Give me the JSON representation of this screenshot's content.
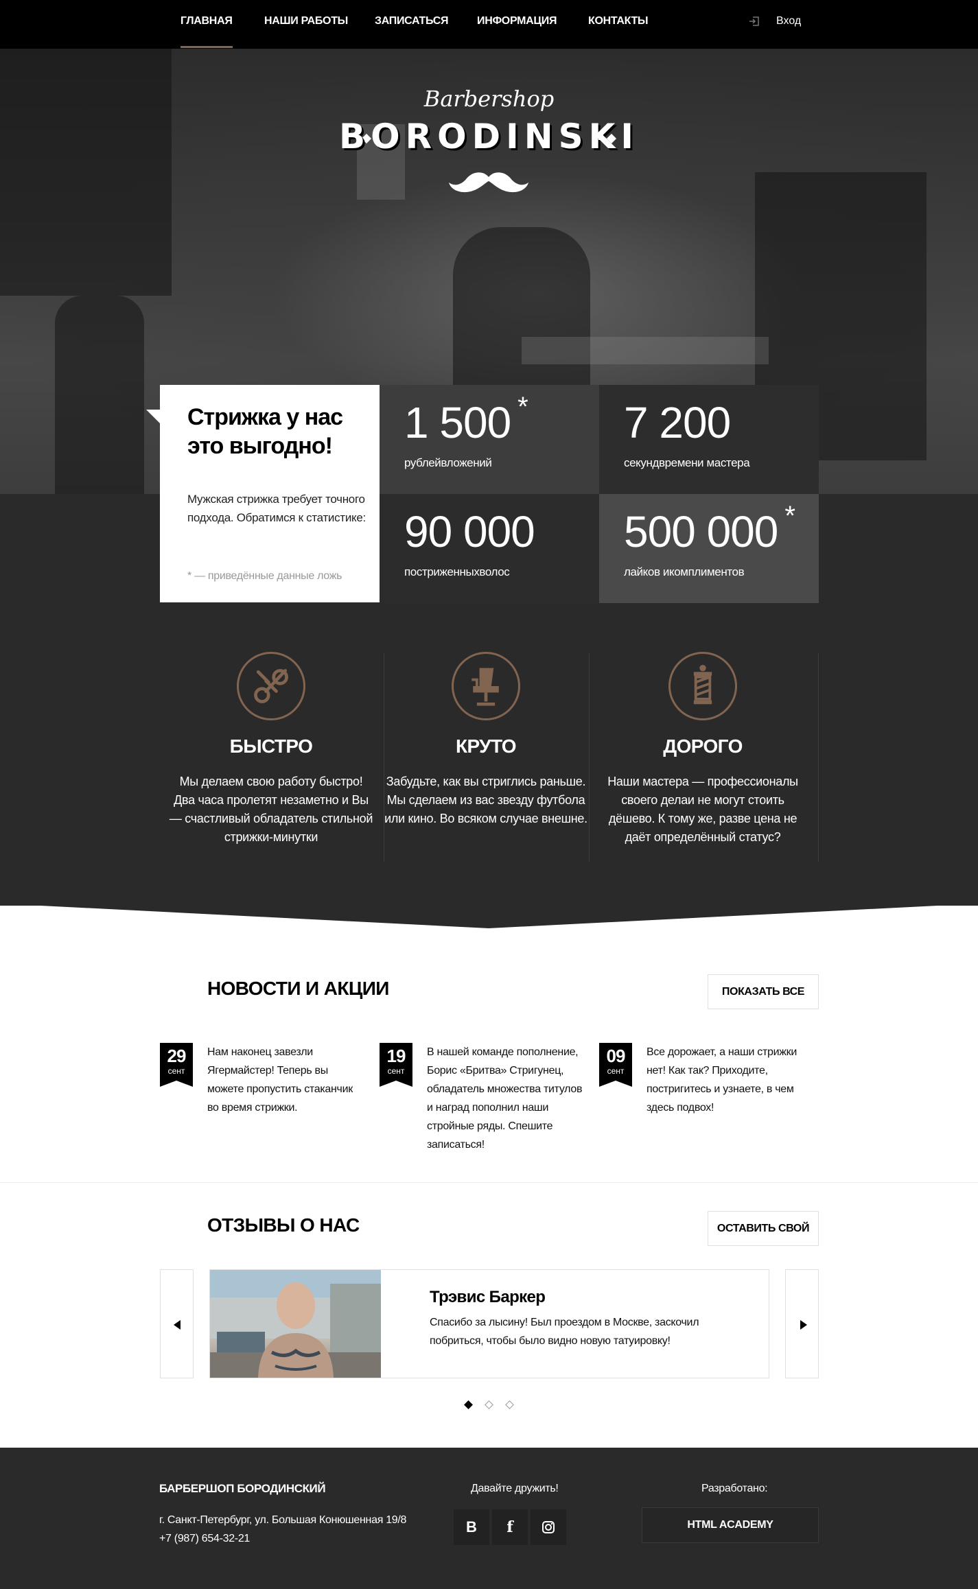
{
  "nav": {
    "items": [
      {
        "label": "ГЛАВНАЯ",
        "active": true
      },
      {
        "label": "НАШИ РАБОТЫ",
        "active": false
      },
      {
        "label": "ЗАПИСАТЬСЯ",
        "active": false
      },
      {
        "label": "ИНФОРМАЦИЯ",
        "active": false
      },
      {
        "label": "КОНТАКТЫ",
        "active": false
      }
    ],
    "login_label": "Вход",
    "login_icon": "login-arrow-icon"
  },
  "hero": {
    "logo_script": "Barbershop",
    "logo_main": "BORODINSKI",
    "logo_icon": "mustache-icon"
  },
  "stats": {
    "title": "Стрижка у нас это выгодно!",
    "text": "Мужская стрижка требует точного подхода. Обратимся к статистике:",
    "note": "* — приведённые данные ложь",
    "cells": [
      {
        "value": "1 500",
        "star": "*",
        "label": "рублейвложений"
      },
      {
        "value": "7 200",
        "star": "",
        "label": "секундвремени мастера"
      },
      {
        "value": "90 000",
        "star": "",
        "label": "постриженныхволос"
      },
      {
        "value": "500 000",
        "star": "*",
        "label": "лайков икомплиментов"
      }
    ]
  },
  "features": [
    {
      "icon": "scissors-icon",
      "title": "БЫСТРО",
      "text": "Мы делаем свою работу быстро! Два часа пролетят незаметно и Вы — счастливый обладатель стильной стрижки-минутки"
    },
    {
      "icon": "barber-chair-icon",
      "title": "КРУТО",
      "text": "Забудьте, как вы стриглись раньше. Мы сделаем из вас звезду футбола или кино. Во всяком случае внешне."
    },
    {
      "icon": "barber-pole-icon",
      "title": "ДОРОГО",
      "text": "Наши мастера — профессионалы своего делаи не могут стоить дёшево. К тому же, разве цена не даёт определённый статус?"
    }
  ],
  "news": {
    "title": "НОВОСТИ И АКЦИИ",
    "button": "ПОКАЗАТЬ ВСЕ",
    "items": [
      {
        "day": "29",
        "month": "сент",
        "text": "Нам наконец завезли Ягермайстер! Теперь вы можете пропустить стаканчик во время стрижки."
      },
      {
        "day": "19",
        "month": "сент",
        "text": "В нашей команде пополнение, Борис «Бритва» Стригунец, обладатель множества титулов и наград пополнил наши стройные ряды. Спешите записаться!"
      },
      {
        "day": "09",
        "month": "сент",
        "text": "Все дорожает, а наши стрижки нет! Как так? Приходите, постригитесь и узнаете, в чем здесь подвох!"
      }
    ]
  },
  "reviews": {
    "title": "ОТЗЫВЫ О НАС",
    "button": "ОСТАВИТЬ СВОЙ",
    "name": "Трэвис Баркер",
    "text": "Спасибо за лысину! Был проездом в Москве, заскочил побриться, чтобы было видно новую татуировку!",
    "prev_icon": "arrow-left-icon",
    "next_icon": "arrow-right-icon",
    "slides": 3,
    "active_slide": 1
  },
  "footer": {
    "title": "БАРБЕРШОП БОРОДИНСКИЙ",
    "address": "г. Санкт-Петербург, ул. Большая Конюшенная 19/8",
    "phone": "+7 (987) 654-32-21",
    "social_title": "Давайте дружить!",
    "social": [
      {
        "icon": "vk-icon",
        "glyph": "B"
      },
      {
        "icon": "facebook-icon",
        "glyph": "f"
      },
      {
        "icon": "instagram-icon",
        "glyph": ""
      }
    ],
    "dev_title": "Разработано:",
    "dev_logo": "HTML ACADEMY"
  },
  "colors": {
    "accent": "#826550",
    "dark": "#2a2a2a",
    "black": "#000000"
  }
}
